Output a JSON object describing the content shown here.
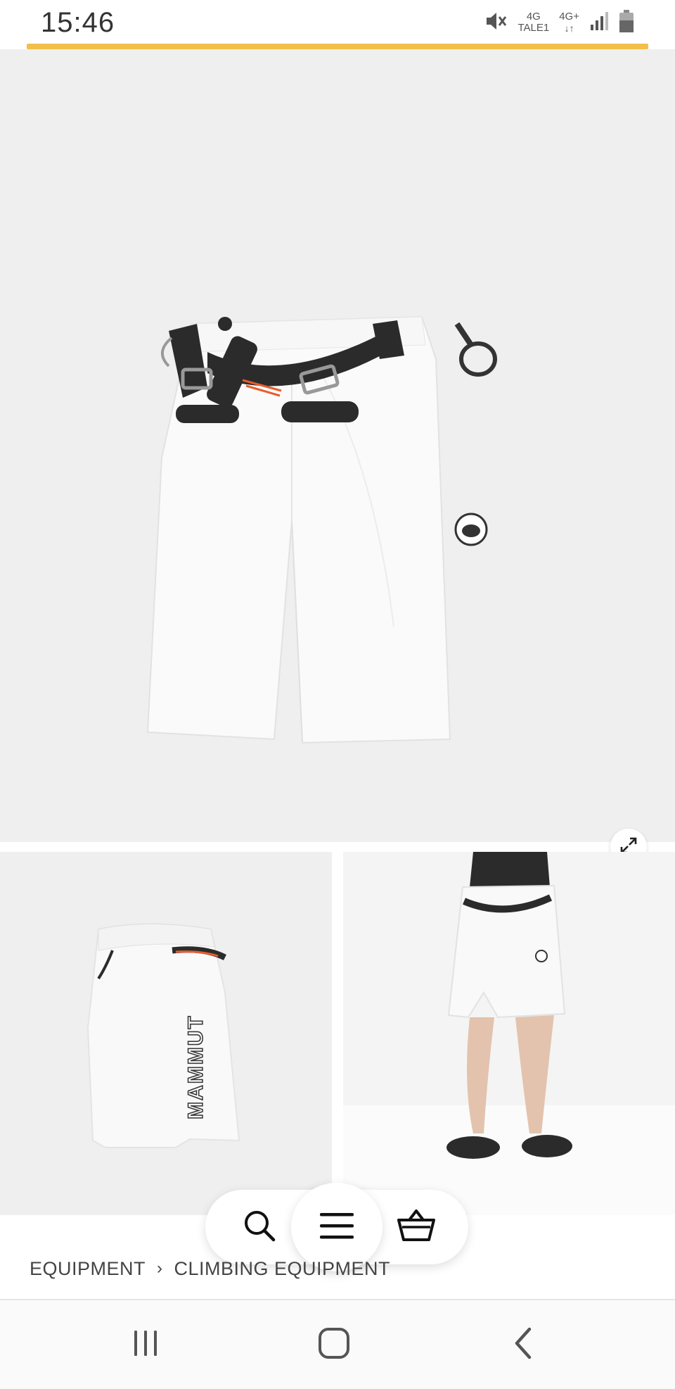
{
  "status_bar": {
    "time": "15:46",
    "network_1": "4G",
    "network_1_sub": "TALE1",
    "network_2": "4G+",
    "icons": [
      "mute-icon",
      "signal-icon",
      "battery-icon"
    ]
  },
  "colors": {
    "progress": "#f2bf4a",
    "gallery_bg": "#efefef",
    "text": "#444444"
  },
  "gallery": {
    "main_image": "white-climbing-shorts-with-harness",
    "thumb_back_image": "shorts-back-view",
    "thumb_back_brand": "MAMMUT",
    "thumb_model_image": "model-wearing-shorts",
    "expand_icon": "expand-icon"
  },
  "floating_nav": {
    "icons": [
      "search-icon",
      "menu-icon",
      "basket-icon"
    ]
  },
  "breadcrumb": {
    "items": [
      "EQUIPMENT",
      "CLIMBING EQUIPMENT"
    ],
    "separator": "›"
  },
  "system_nav": {
    "icons": [
      "recent-apps-icon",
      "home-icon",
      "back-icon"
    ]
  }
}
